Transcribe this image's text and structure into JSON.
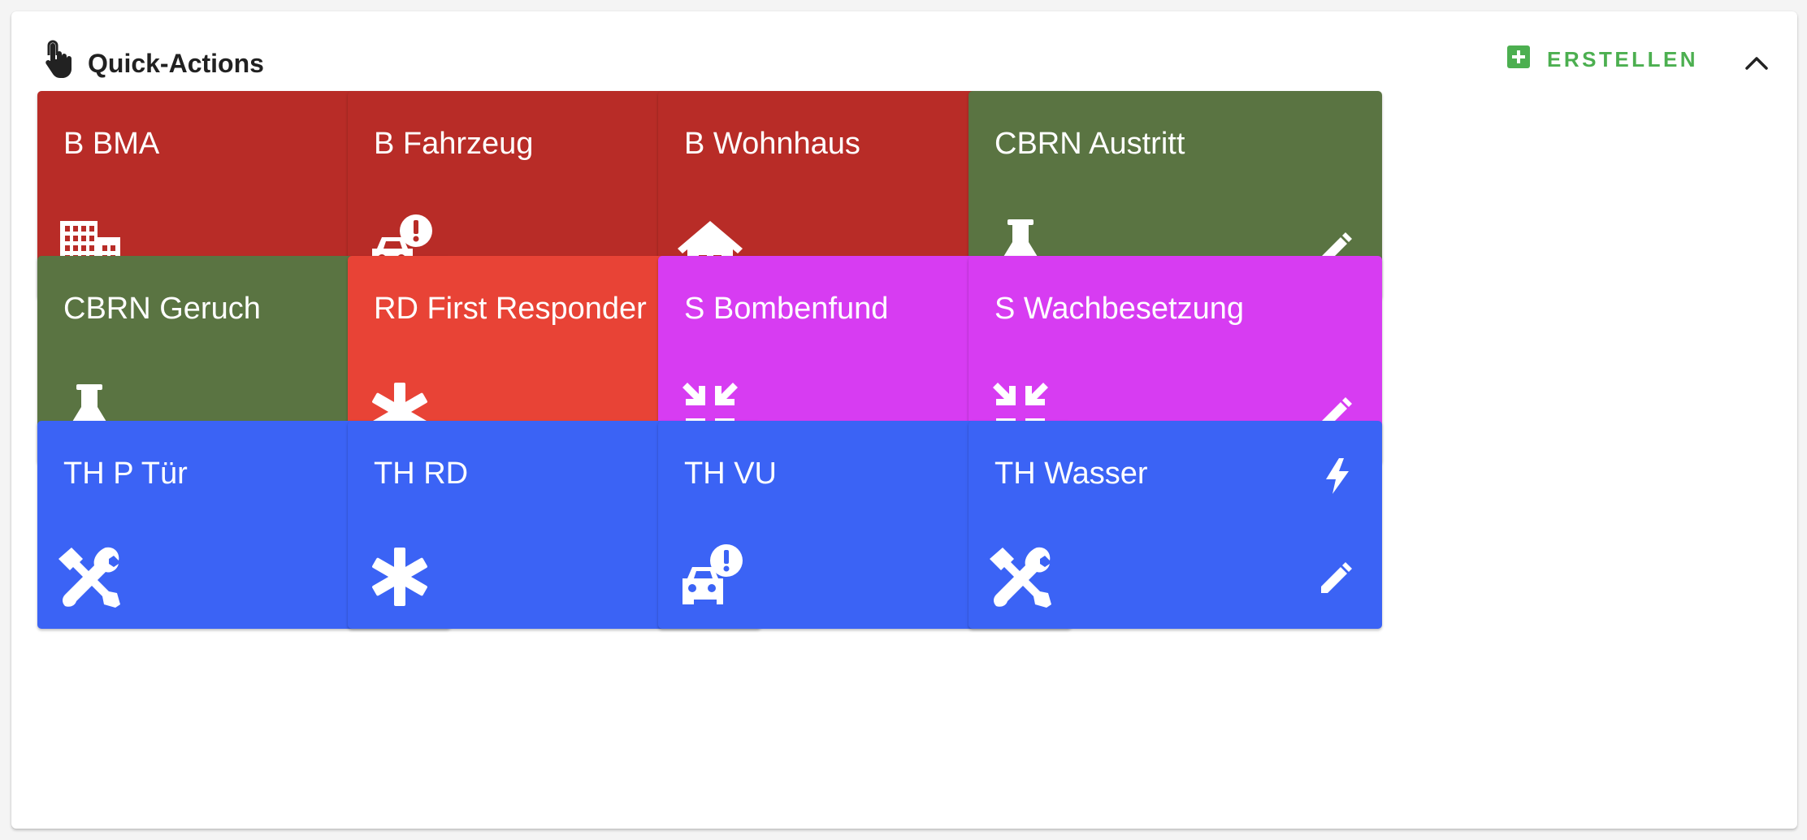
{
  "header": {
    "title": "Quick-Actions",
    "icon": "touch-app-icon",
    "create_label": "ERSTELLEN",
    "create_icon": "add-box-icon",
    "collapse_icon": "chevron-up-icon"
  },
  "colors": {
    "red": "#b82c27",
    "green": "#5a7442",
    "light_red": "#e84336",
    "magenta": "#d73cf2",
    "blue": "#3b63f5",
    "create": "#4caf50"
  },
  "quick_actions": [
    {
      "name": "B BMA",
      "color": "red",
      "icon": "building-icon",
      "flash": false
    },
    {
      "name": "B Fahrzeug",
      "color": "red",
      "icon": "car-alert-icon",
      "flash": true
    },
    {
      "name": "B Wohnhaus",
      "color": "red",
      "icon": "house-icon",
      "flash": true
    },
    {
      "name": "CBRN Austritt",
      "color": "green",
      "icon": "flask-icon",
      "flash": false
    },
    {
      "name": "CBRN Geruch",
      "color": "green",
      "icon": "flask-icon",
      "flash": false
    },
    {
      "name": "RD First Responder",
      "color": "light_red",
      "icon": "asterisk-icon",
      "flash": false
    },
    {
      "name": "S Bombenfund",
      "color": "magenta",
      "icon": "collapse-arrows-icon",
      "flash": false
    },
    {
      "name": "S Wachbesetzung",
      "color": "magenta",
      "icon": "collapse-arrows-icon",
      "flash": false
    },
    {
      "name": "TH P Tür",
      "color": "blue",
      "icon": "tools-icon",
      "flash": true
    },
    {
      "name": "TH RD",
      "color": "blue",
      "icon": "asterisk-icon",
      "flash": true
    },
    {
      "name": "TH VU",
      "color": "blue",
      "icon": "car-alert-icon",
      "flash": true
    },
    {
      "name": "TH Wasser",
      "color": "blue",
      "icon": "tools-icon",
      "flash": true
    }
  ]
}
